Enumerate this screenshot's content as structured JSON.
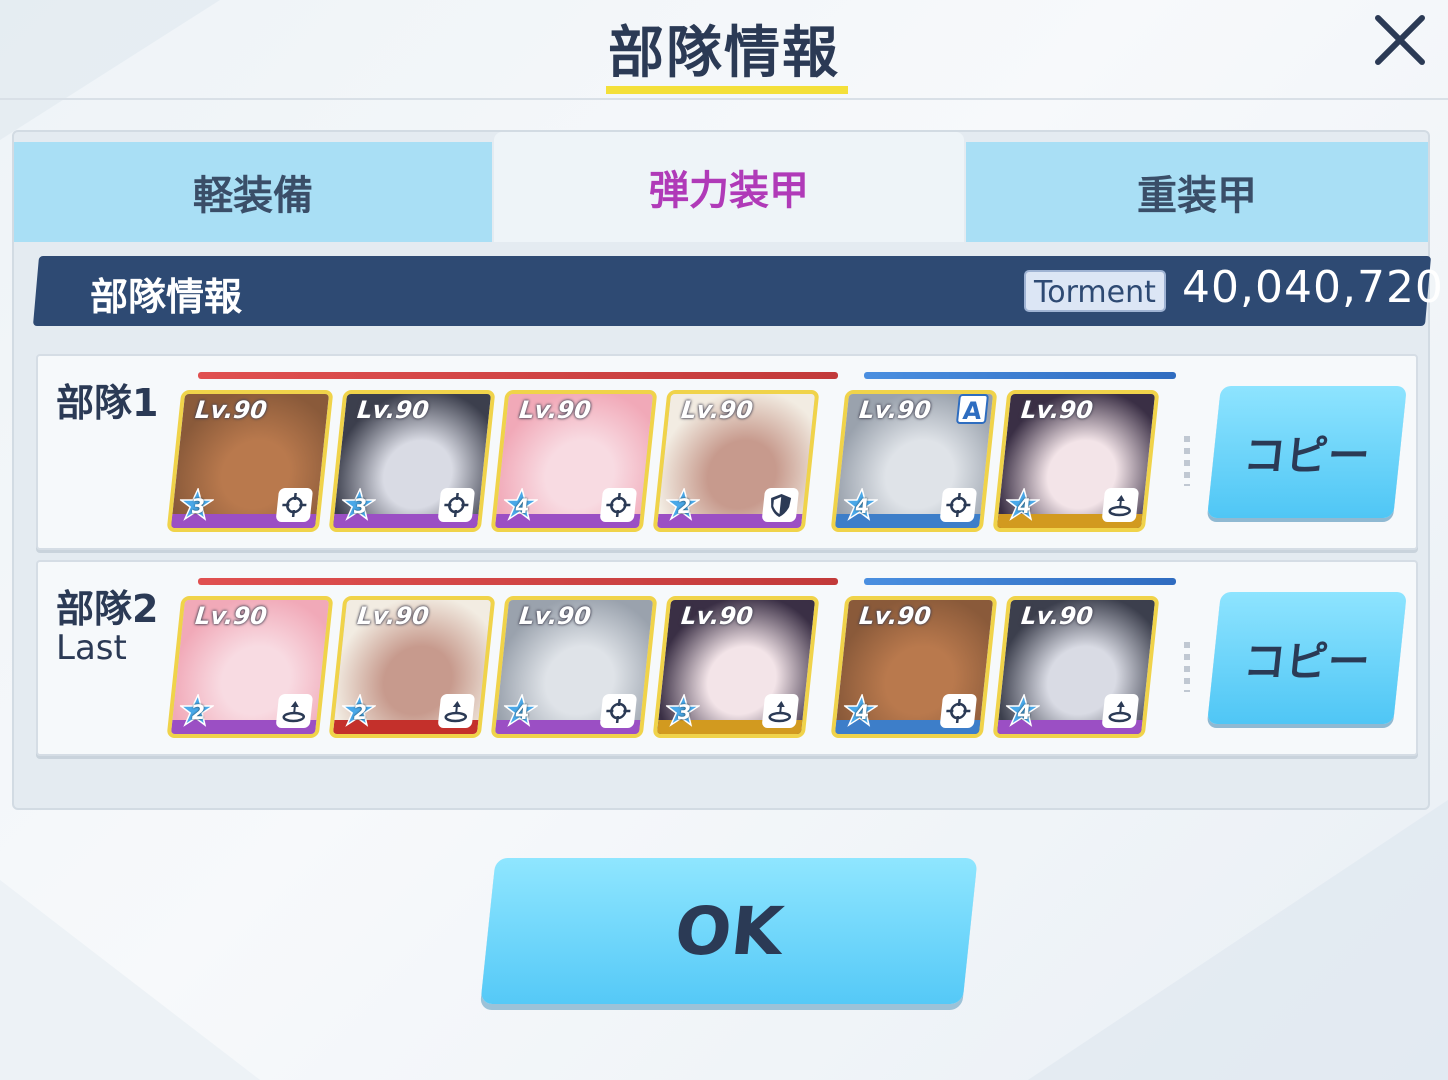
{
  "header": {
    "title": "部隊情報"
  },
  "tabs": [
    {
      "label": "軽装備"
    },
    {
      "label": "弾力装甲"
    },
    {
      "label": "重装甲"
    }
  ],
  "info_bar": {
    "title": "部隊情報",
    "mode_badge": "Torment",
    "score": "40,040,720"
  },
  "squads": [
    {
      "name": "部隊1",
      "sub": "",
      "copy_label": "コピー",
      "members": [
        {
          "level": "Lv.90",
          "stars": "3",
          "role": "crosshair-icon",
          "strip_color": "#9b4fc4"
        },
        {
          "level": "Lv.90",
          "stars": "3",
          "role": "crosshair-icon",
          "strip_color": "#9b4fc4"
        },
        {
          "level": "Lv.90",
          "stars": "4",
          "role": "crosshair-icon",
          "strip_color": "#9b4fc4"
        },
        {
          "level": "Lv.90",
          "stars": "2",
          "role": "shield-icon",
          "strip_color": "#9b4fc4"
        },
        {
          "level": "Lv.90",
          "stars": "4",
          "role": "crosshair-icon",
          "strip_color": "#3d7ec9",
          "assist": "A"
        },
        {
          "level": "Lv.90",
          "stars": "4",
          "role": "support-icon",
          "strip_color": "#d29a1f"
        }
      ]
    },
    {
      "name": "部隊2",
      "sub": "Last",
      "copy_label": "コピー",
      "members": [
        {
          "level": "Lv.90",
          "stars": "2",
          "role": "support-icon",
          "strip_color": "#9b4fc4"
        },
        {
          "level": "Lv.90",
          "stars": "2",
          "role": "support-icon",
          "strip_color": "#c4302b"
        },
        {
          "level": "Lv.90",
          "stars": "4",
          "role": "crosshair-icon",
          "strip_color": "#9b4fc4"
        },
        {
          "level": "Lv.90",
          "stars": "3",
          "role": "support-icon",
          "strip_color": "#d29a1f"
        },
        {
          "level": "Lv.90",
          "stars": "4",
          "role": "crosshair-icon",
          "strip_color": "#3d7ec9"
        },
        {
          "level": "Lv.90",
          "stars": "4",
          "role": "support-icon",
          "strip_color": "#9b4fc4"
        }
      ]
    }
  ],
  "ok_label": "OK",
  "colors": {
    "accent_underline": "#f4e03a",
    "active_tab_text": "#b03ab8",
    "info_bar": "#2e4a73",
    "button": "#55c9f7"
  }
}
